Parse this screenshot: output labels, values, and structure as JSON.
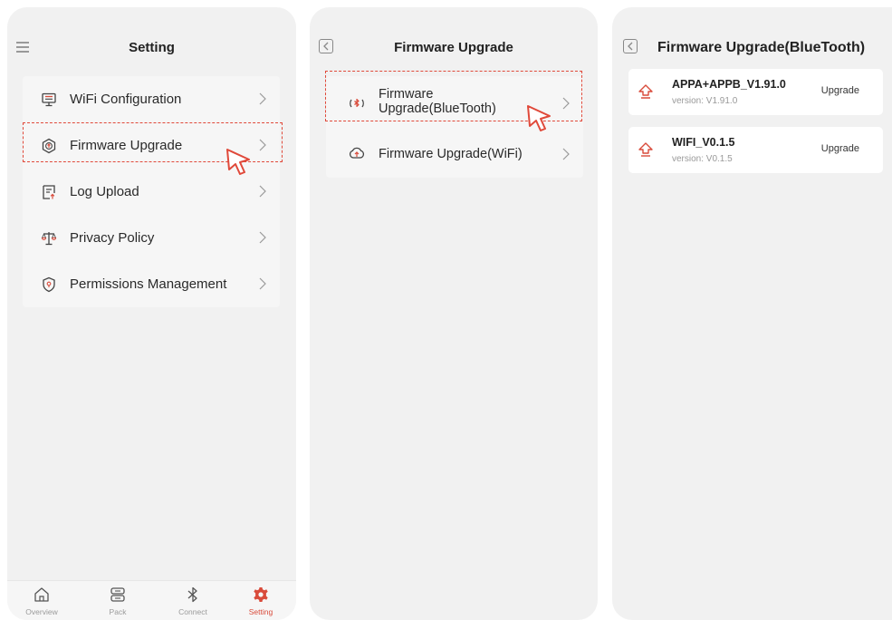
{
  "screen1": {
    "title": "Setting",
    "menu": [
      {
        "label": "WiFi Configuration",
        "icon": "monitor-icon"
      },
      {
        "label": "Firmware Upgrade",
        "icon": "upgrade-icon"
      },
      {
        "label": "Log Upload",
        "icon": "log-icon"
      },
      {
        "label": "Privacy Policy",
        "icon": "scale-icon"
      },
      {
        "label": "Permissions Management",
        "icon": "shield-icon"
      }
    ],
    "nav": [
      {
        "label": "Overview",
        "icon": "home-icon"
      },
      {
        "label": "Pack",
        "icon": "battery-pack-icon"
      },
      {
        "label": "Connect",
        "icon": "bluetooth-icon"
      },
      {
        "label": "Setting",
        "icon": "gear-icon"
      }
    ]
  },
  "screen2": {
    "title": "Firmware Upgrade",
    "items": [
      {
        "label_line1": "Firmware",
        "label_line2": "Upgrade(BlueTooth)",
        "icon": "bluetooth-sync-icon"
      },
      {
        "label": "Firmware Upgrade(WiFi)",
        "icon": "cloud-upload-icon"
      }
    ]
  },
  "screen3": {
    "title": "Firmware Upgrade(BlueTooth)",
    "firmware": [
      {
        "name": "APPA+APPB_V1.91.0",
        "version": "version: V1.91.0",
        "action": "Upgrade",
        "icon": "upgrade-arrow-icon"
      },
      {
        "name": "WIFI_V0.1.5",
        "version": "version: V0.1.5",
        "action": "Upgrade",
        "icon": "upgrade-arrow-icon"
      }
    ]
  },
  "colors": {
    "accent": "#d94b3b",
    "background": "#f1f1f1",
    "card": "#f6f6f6"
  }
}
